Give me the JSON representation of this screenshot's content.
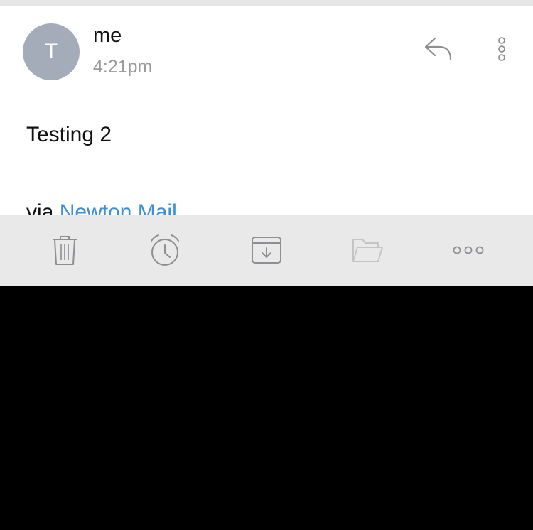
{
  "message": {
    "avatar_letter": "T",
    "sender": "me",
    "time": "4:21pm",
    "body": "Testing 2",
    "signature_prefix": "via ",
    "signature_link": "Newton Mail"
  },
  "header_actions": {
    "reply_icon": "reply-icon",
    "more_icon": "more-vertical-icon"
  },
  "toolbar": {
    "buttons": [
      {
        "icon": "trash-icon",
        "enabled": true
      },
      {
        "icon": "alarm-clock-icon",
        "enabled": true
      },
      {
        "icon": "archive-icon",
        "enabled": true
      },
      {
        "icon": "folder-icon",
        "enabled": false
      },
      {
        "icon": "more-horizontal-icon",
        "enabled": true
      }
    ]
  },
  "colors": {
    "avatar_bg": "#a3acb8",
    "link": "#3d8fd9",
    "toolbar_bg": "#e9e9e9",
    "icon": "#8e8e93",
    "icon_disabled": "#c4c4c4"
  }
}
